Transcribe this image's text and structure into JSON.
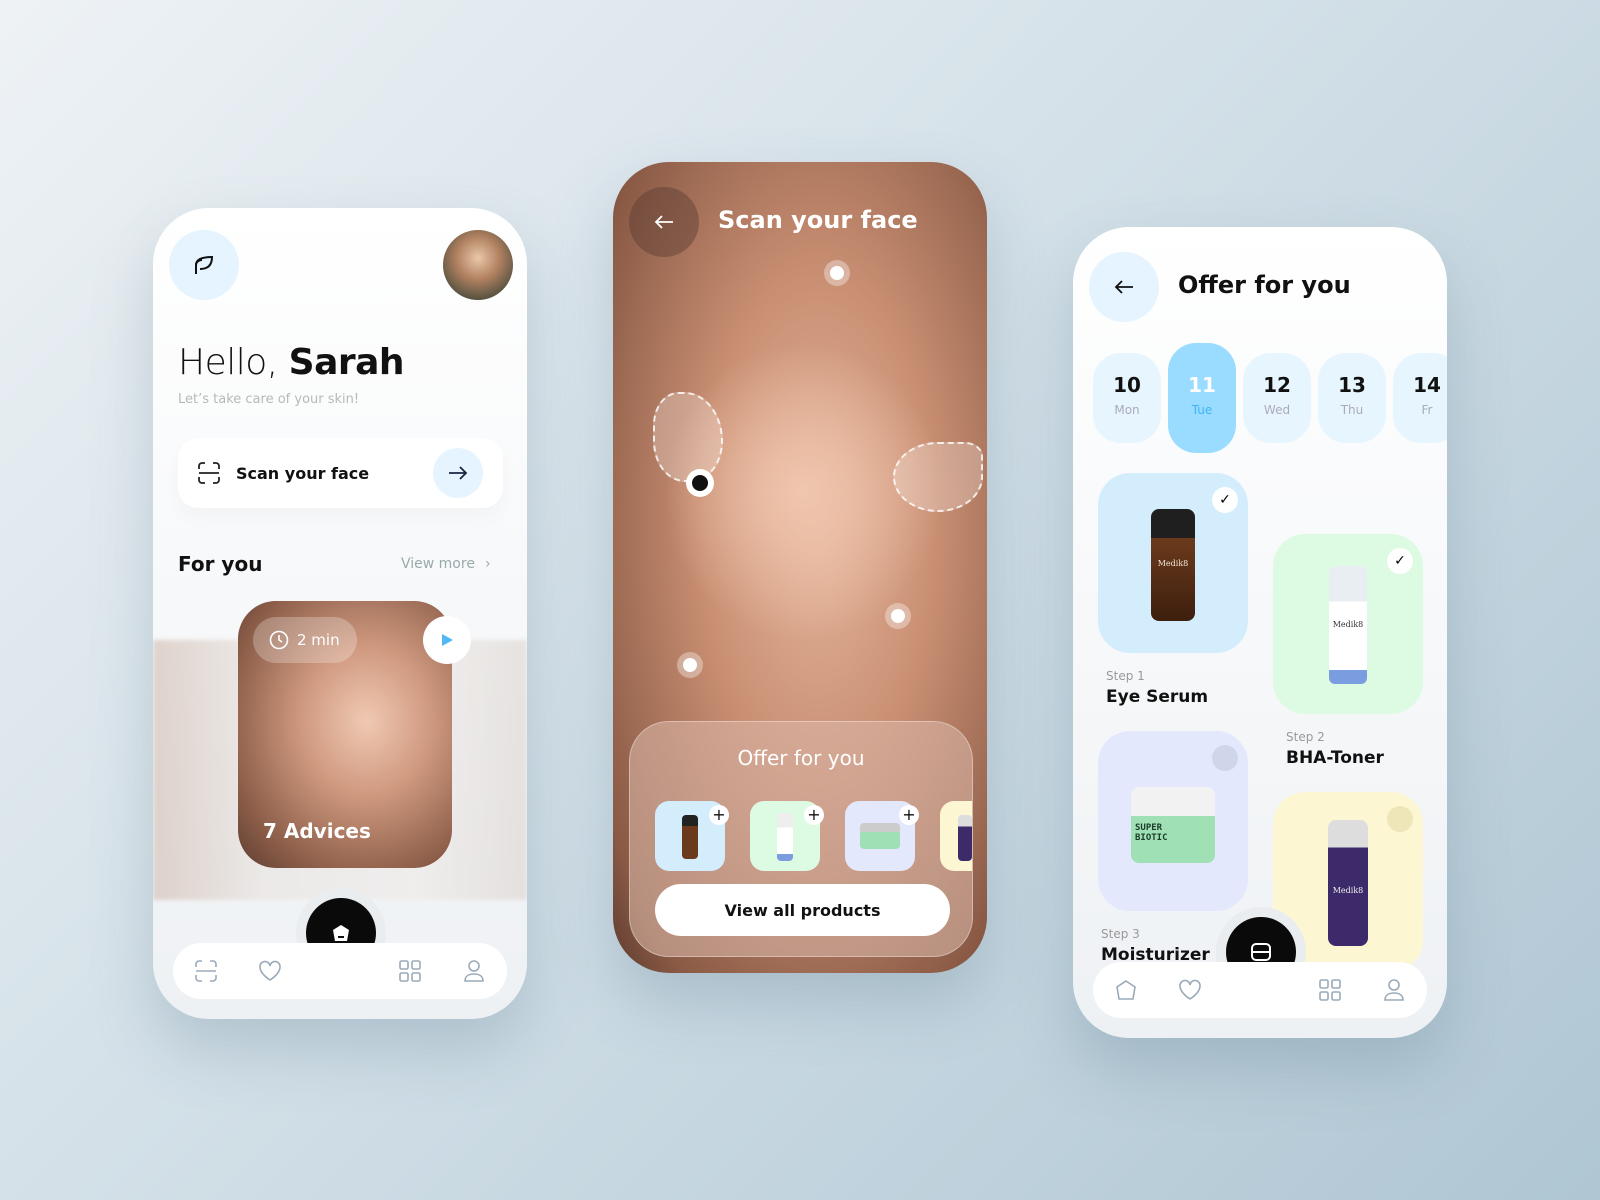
{
  "home": {
    "greeting": "Hello,",
    "name": "Sarah",
    "subtitle": "Let’s take care of your skin!",
    "scan_label": "Scan your face",
    "section_title": "For you",
    "view_more": "View more",
    "video_duration": "2 min",
    "video_title": "7 Advices"
  },
  "scan": {
    "title": "Scan your face",
    "offer_title": "Offer for you",
    "view_all": "View all products"
  },
  "offer": {
    "title": "Offer for you",
    "days": [
      {
        "num": "10",
        "day": "Mon"
      },
      {
        "num": "11",
        "day": "Tue",
        "selected": true
      },
      {
        "num": "12",
        "day": "Wed"
      },
      {
        "num": "13",
        "day": "Thu"
      },
      {
        "num": "14",
        "day": "Fr"
      }
    ],
    "products": [
      {
        "step": "Step 1",
        "name": "Eye Serum",
        "checked": true,
        "color": "#d4edfd"
      },
      {
        "step": "Step 2",
        "name": "BHA-Toner",
        "checked": true,
        "color": "#ddfbe3"
      },
      {
        "step": "Step 3",
        "name": "Moisturizer",
        "checked": false,
        "color": "#e3e8fd"
      },
      {
        "step": "",
        "name": "",
        "checked": false,
        "color": "#fdf6d3"
      }
    ],
    "brand": "Medik8",
    "jar_label": "SUPER BIOTIC"
  },
  "colors": {
    "accent": "#9adcff",
    "accent_text": "#3eb4f5",
    "dark": "#0a0a0a",
    "light_blue": "#e7f5fe"
  }
}
